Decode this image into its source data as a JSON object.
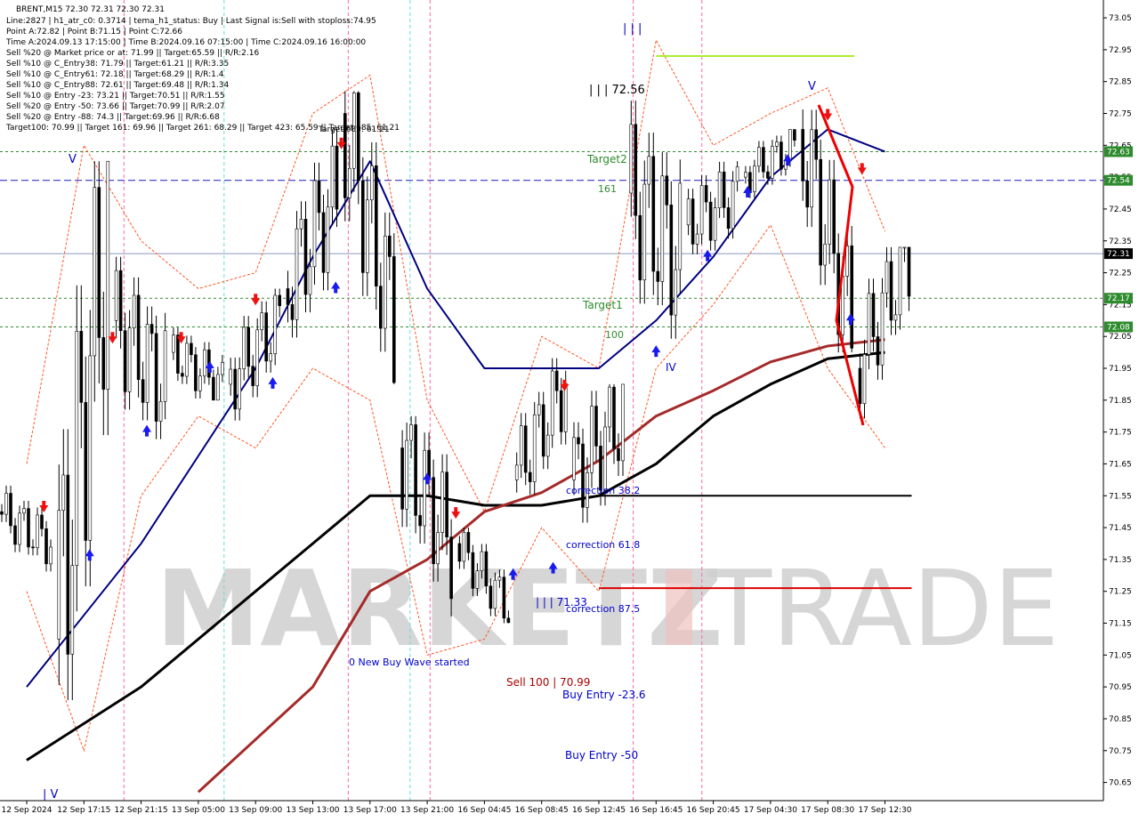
{
  "header": {
    "symbol": "BRENT,M15  72.30 72.31 72.30 72.31",
    "info_lines": [
      "Line:2827 | h1_atr_c0: 0.3714 | tema_h1_status: Buy | Last Signal is:Sell with stoploss:74.95",
      "Point A:72.82 | Point B:71.15 | Point C:72.66",
      "Time A:2024.09.13 17:15:00 | Time B:2024.09.16 07:15:00 | Time C:2024.09.16 16:00:00",
      "Sell %20 @ Market price or at: 71.99 || Target:65.59 || R/R:2.16",
      "Sell %10 @ C_Entry38: 71.79 || Target:61.21 || R/R:3.35",
      "Sell %10 @ C_Entry61: 72.18 || Target:68.29 || R/R:1.4",
      "Sell %10 @ C_Entry88: 72.61 || Target:69.48 || R/R:1.34",
      "Sell %10 @ Entry -23: 73.21 || Target:70.51 || R/R:1.55",
      "Sell %20 @ Entry -50: 73.66 || Target:70.99 || R/R:2.07",
      "Sell %20 @ Entry -88: 74.3 || Target:69.96 || R/R:6.68",
      "Target100: 70.99 || Target 161: 69.96 || Target 261: 68.29 || Target 423: 65.59 || Target 685: 61.21"
    ]
  },
  "watermark": {
    "left": "MARKETZ",
    "right": "TRADE"
  },
  "annotations": {
    "wave_top_label": "| | | 72.56",
    "wave_low_label": "| | | 71.33",
    "marker_iii_top": "| | |",
    "marker_v_left": "V",
    "marker_v_right": "V",
    "marker_iv_right": "IV",
    "marker_iv_bottom": "| V",
    "target2": "Target2",
    "target1": "Target1",
    "level_161": "161",
    "level_100": "100",
    "correction_38": "correction 38.2",
    "correction_61": "correction 61.8",
    "correction_87": "correction 87.5",
    "new_buy_wave": "0 New Buy Wave started",
    "sell_100": "Sell 100 | 70.99",
    "buy_entry_23": "Buy Entry -23.6",
    "buy_entry_50": "Buy Entry -50",
    "target_685_top": "Target 685: 61.21"
  },
  "chart_data": {
    "type": "candlestick",
    "title": "BRENT,M15",
    "ylim": [
      70.6,
      73.1
    ],
    "ytick_labels": [
      "73.05",
      "72.95",
      "72.85",
      "72.75",
      "72.65",
      "72.55",
      "72.45",
      "72.35",
      "72.25",
      "72.15",
      "72.05",
      "71.95",
      "71.85",
      "71.75",
      "71.65",
      "71.55",
      "71.45",
      "71.35",
      "71.25",
      "71.15",
      "71.05",
      "70.95",
      "70.85",
      "70.75",
      "70.65"
    ],
    "xtick_labels": [
      "12 Sep 2024",
      "12 Sep 17:15",
      "12 Sep 21:15",
      "13 Sep 05:00",
      "13 Sep 09:00",
      "13 Sep 13:00",
      "13 Sep 17:00",
      "13 Sep 21:00",
      "16 Sep 04:45",
      "16 Sep 08:45",
      "16 Sep 12:45",
      "16 Sep 16:45",
      "16 Sep 20:45",
      "17 Sep 04:30",
      "17 Sep 08:30",
      "17 Sep 12:30"
    ],
    "current_price": 72.31,
    "price_tags": [
      {
        "value": 72.63,
        "label": "72.63",
        "color": "#2e8b2e"
      },
      {
        "value": 72.54,
        "label": "72.54",
        "color": "#2e8b2e"
      },
      {
        "value": 72.31,
        "label": "72.31",
        "color": "#000000"
      },
      {
        "value": 72.17,
        "label": "72.17",
        "color": "#2e8b2e"
      },
      {
        "value": 72.08,
        "label": "72.08",
        "color": "#2e8b2e"
      }
    ],
    "horizontal_levels": [
      {
        "value": 72.63,
        "style": "dotted",
        "color": "#2e8b2e"
      },
      {
        "value": 72.54,
        "style": "dashed",
        "color": "#1a1acc"
      },
      {
        "value": 72.31,
        "style": "solid",
        "color": "#8899bb"
      },
      {
        "value": 72.17,
        "style": "dotted",
        "color": "#2e8b2e"
      },
      {
        "value": 72.08,
        "style": "dotted",
        "color": "#2e8b2e"
      }
    ],
    "segments": [
      {
        "name": "target-line-72-93",
        "x": [
          "16 Sep 16:45",
          "17 Sep 08:30"
        ],
        "y": [
          72.93,
          72.93
        ],
        "color": "#aaee33"
      },
      {
        "name": "entry-line-71-55",
        "x": [
          "16 Sep 12:45",
          "17 Sep 12:30"
        ],
        "y": [
          71.55,
          71.55
        ],
        "color": "#000000"
      },
      {
        "name": "sell-line-71-26",
        "x": [
          "16 Sep 12:45",
          "17 Sep 12:30"
        ],
        "y": [
          71.26,
          71.26
        ],
        "color": "#dd0000"
      }
    ],
    "candles": [
      {
        "x": "12 Sep 2024",
        "o": 71.5,
        "h": 71.6,
        "l": 71.3,
        "c": 71.4
      },
      {
        "x": "12 Sep 17:15",
        "o": 71.1,
        "h": 72.6,
        "l": 70.8,
        "c": 72.4
      },
      {
        "x": "12 Sep 21:15",
        "o": 72.1,
        "h": 72.3,
        "l": 71.6,
        "c": 71.9
      },
      {
        "x": "13 Sep 05:00",
        "o": 72.0,
        "h": 72.15,
        "l": 71.85,
        "c": 71.9
      },
      {
        "x": "13 Sep 09:00",
        "o": 71.9,
        "h": 72.2,
        "l": 71.75,
        "c": 72.1
      },
      {
        "x": "13 Sep 13:00",
        "o": 72.2,
        "h": 72.7,
        "l": 72.0,
        "c": 72.5
      },
      {
        "x": "13 Sep 17:00",
        "o": 72.75,
        "h": 72.82,
        "l": 71.9,
        "c": 72.1
      },
      {
        "x": "13 Sep 21:00",
        "o": 71.7,
        "h": 71.8,
        "l": 71.1,
        "c": 71.4
      },
      {
        "x": "16 Sep 04:45",
        "o": 71.4,
        "h": 71.45,
        "l": 71.15,
        "c": 71.2
      },
      {
        "x": "16 Sep 08:45",
        "o": 71.6,
        "h": 72.0,
        "l": 71.5,
        "c": 71.9
      },
      {
        "x": "16 Sep 12:45",
        "o": 71.6,
        "h": 71.9,
        "l": 71.3,
        "c": 71.8
      },
      {
        "x": "16 Sep 16:45",
        "o": 72.5,
        "h": 72.93,
        "l": 72.0,
        "c": 72.3
      },
      {
        "x": "16 Sep 20:45",
        "o": 72.4,
        "h": 72.6,
        "l": 72.2,
        "c": 72.5
      },
      {
        "x": "17 Sep 04:30",
        "o": 72.55,
        "h": 72.7,
        "l": 72.45,
        "c": 72.65
      },
      {
        "x": "17 Sep 08:30",
        "o": 72.7,
        "h": 72.78,
        "l": 72.0,
        "c": 72.1
      },
      {
        "x": "17 Sep 12:30",
        "o": 71.95,
        "h": 72.33,
        "l": 71.75,
        "c": 72.31
      }
    ],
    "series": [
      {
        "name": "",
        "color": "#000080",
        "points": [
          [
            0,
            70.95
          ],
          [
            2,
            71.4
          ],
          [
            4,
            71.95
          ],
          [
            5,
            72.3
          ],
          [
            6,
            72.6
          ],
          [
            7,
            72.2
          ],
          [
            8,
            71.95
          ],
          [
            9,
            71.95
          ],
          [
            10,
            71.95
          ],
          [
            11,
            72.1
          ],
          [
            12,
            72.3
          ],
          [
            13,
            72.55
          ],
          [
            14,
            72.7
          ],
          [
            15,
            72.63
          ]
        ]
      },
      {
        "name": "",
        "color": "#000000",
        "points": [
          [
            0,
            70.72
          ],
          [
            2,
            70.95
          ],
          [
            4,
            71.25
          ],
          [
            5,
            71.4
          ],
          [
            6,
            71.55
          ],
          [
            7,
            71.55
          ],
          [
            8,
            71.52
          ],
          [
            9,
            71.52
          ],
          [
            10,
            71.55
          ],
          [
            11,
            71.65
          ],
          [
            12,
            71.8
          ],
          [
            13,
            71.9
          ],
          [
            14,
            71.98
          ],
          [
            15,
            72.0
          ]
        ]
      },
      {
        "name": "",
        "color": "#a52a2a",
        "points": [
          [
            3,
            70.62
          ],
          [
            5,
            70.95
          ],
          [
            6,
            71.25
          ],
          [
            7,
            71.35
          ],
          [
            8,
            71.5
          ],
          [
            9,
            71.56
          ],
          [
            10,
            71.66
          ],
          [
            11,
            71.8
          ],
          [
            12,
            71.88
          ],
          [
            13,
            71.97
          ],
          [
            14,
            72.02
          ],
          [
            15,
            72.04
          ]
        ]
      }
    ]
  }
}
